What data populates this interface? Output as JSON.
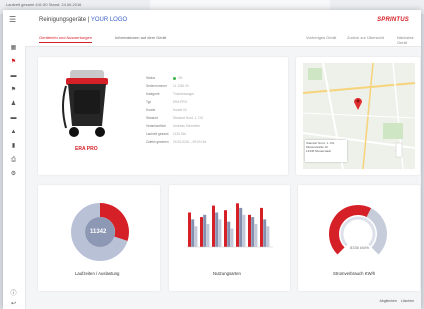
{
  "background_window": {
    "status_text": "Laufzeit gesamt   441:50  Stand: 24.06.2016"
  },
  "header": {
    "title": "Reinigungsgeräte |",
    "logo_text": "YOUR LOGO",
    "brand": "SPRINTUS"
  },
  "tabs": {
    "items": [
      {
        "label": "Geräteinfo und Auswertungen",
        "active": true
      },
      {
        "label": "Informationen auf dem Gerät",
        "active": false
      }
    ],
    "right": [
      "Vorheriges Gerät",
      "Zurück zur Übersicht",
      "Nächstes Gerät"
    ]
  },
  "device": {
    "name": "ERA PRO",
    "info": [
      {
        "label": "Status",
        "value": "OK"
      },
      {
        "label": "Seriennummer",
        "value": "11 1281 00"
      },
      {
        "label": "Kategorie",
        "value": "Trockensauger"
      },
      {
        "label": "Typ",
        "value": "ERA PRO"
      },
      {
        "label": "Kunde",
        "value": "Kunde 02"
      },
      {
        "label": "Standort",
        "value": "Standort Nord, 1. OG"
      },
      {
        "label": "Verantwortlich",
        "value": "Andreas Schneider"
      },
      {
        "label": "Laufzeit gesamt",
        "value": "1126 Std."
      },
      {
        "label": "Zuletzt gesehen",
        "value": "24.06.2016 – 09:00 Uhr"
      }
    ]
  },
  "map": {
    "popup_title": "Standort Nord, 1. OG",
    "popup_line2": "Musterstraße 10",
    "popup_line3": "12345 Musterstadt"
  },
  "charts": {
    "donut_value": "11342",
    "labels": [
      "Laufzeiten / Auslastung",
      "Nutzungsarten",
      "Stromverbrauch KW/h"
    ],
    "gauge_value": "8336 kW/h"
  },
  "chart_data": [
    {
      "type": "pie",
      "title": "Laufzeiten / Auslastung",
      "center_label": "11342",
      "values": [
        30,
        70
      ],
      "colors": [
        "#d52027",
        "#b8c1d6"
      ]
    },
    {
      "type": "bar",
      "title": "Nutzungsarten",
      "categories": [
        "1",
        "2",
        "3",
        "4",
        "5",
        "6",
        "7"
      ],
      "series": [
        {
          "values": [
            75,
            65,
            90,
            80,
            95,
            70,
            85
          ],
          "color": "#d52027"
        },
        {
          "values": [
            60,
            70,
            75,
            55,
            85,
            65,
            60
          ],
          "color": "#8490ae"
        },
        {
          "values": [
            45,
            50,
            60,
            40,
            70,
            50,
            45
          ],
          "color": "#c3c9d8"
        }
      ],
      "ylim": [
        0,
        100
      ]
    },
    {
      "type": "pie",
      "title": "Stromverbrauch KW/h",
      "center_label": "8336 kW/h",
      "values": [
        60,
        40
      ],
      "colors": [
        "#d52027",
        "#c6ccda"
      ]
    }
  ],
  "footer": {
    "right_items": [
      "Abgleichen",
      "Löschen"
    ]
  },
  "colors": {
    "accent": "#d52027",
    "link": "#3a62c8",
    "status_ok": "#3bb44a"
  }
}
